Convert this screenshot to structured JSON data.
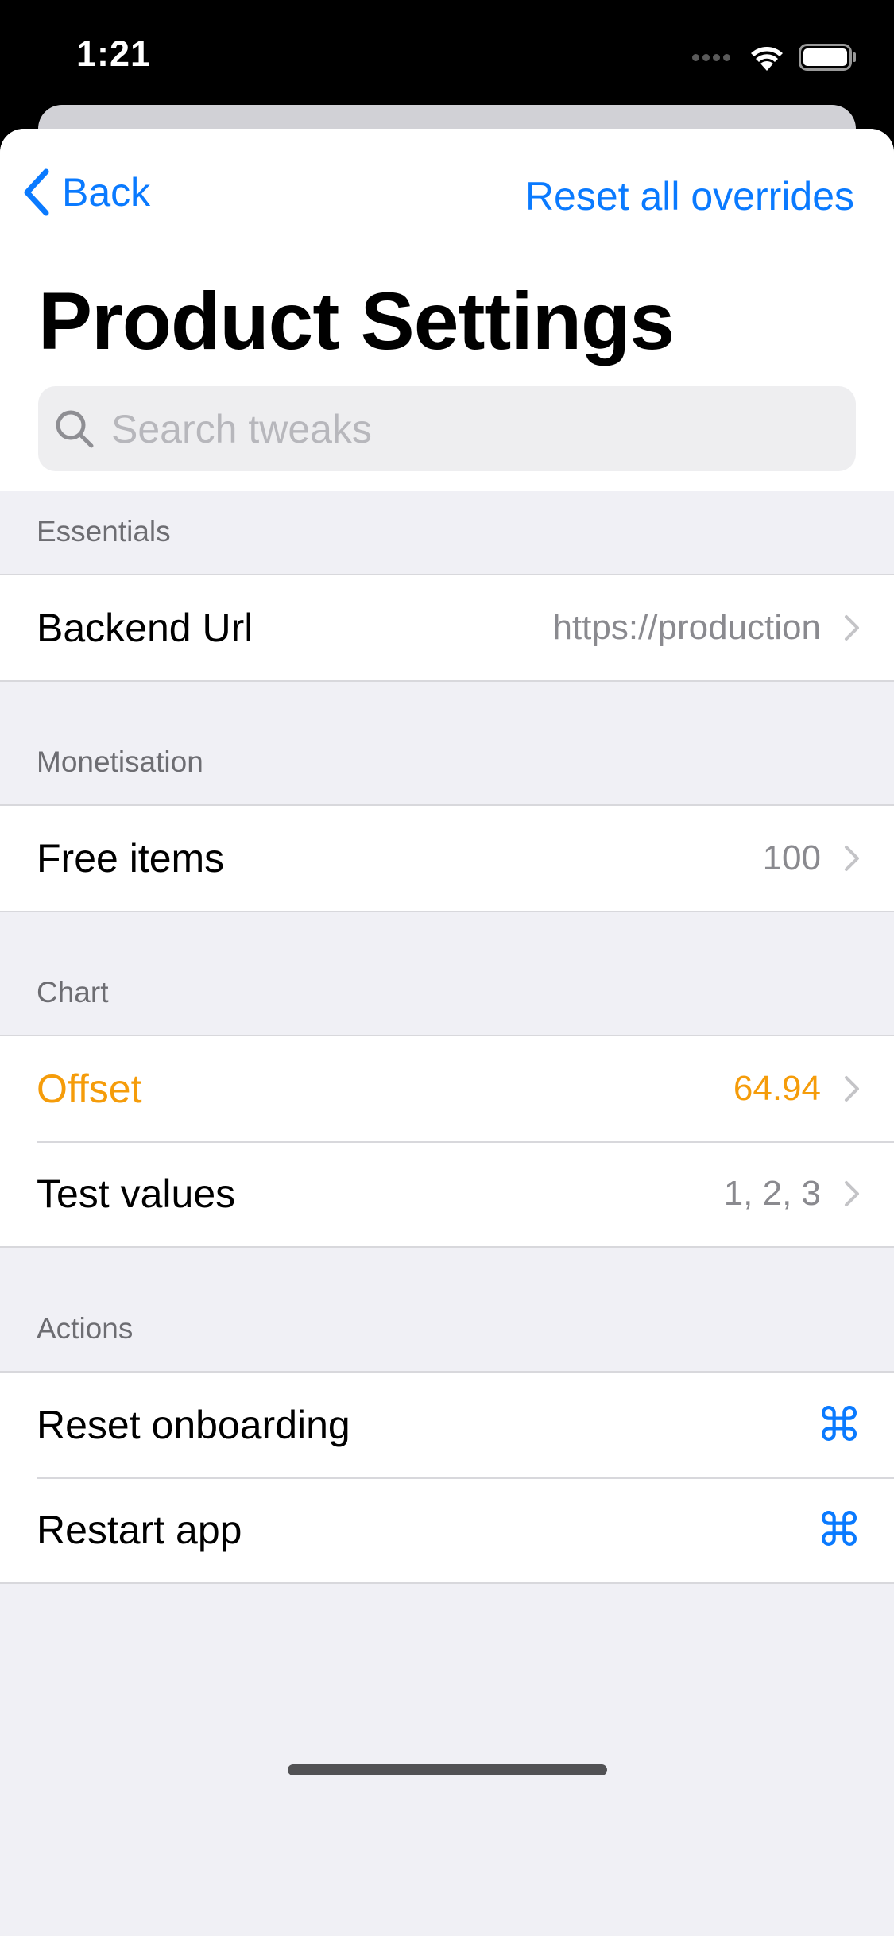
{
  "status_bar": {
    "time": "1:21",
    "icons": [
      "signal-dots-icon",
      "wifi-icon",
      "battery-icon"
    ]
  },
  "nav": {
    "back_label": "Back",
    "reset_label": "Reset all overrides"
  },
  "title": "Product Settings",
  "search": {
    "placeholder": "Search tweaks",
    "value": ""
  },
  "sections": [
    {
      "header": "Essentials",
      "rows": [
        {
          "label": "Backend Url",
          "value": "https://production"
        }
      ]
    },
    {
      "header": "Monetisation",
      "rows": [
        {
          "label": "Free items",
          "value": "100"
        }
      ]
    },
    {
      "header": "Chart",
      "rows": [
        {
          "label": "Offset",
          "value": "64.94",
          "overridden": true
        },
        {
          "label": "Test values",
          "value": "1, 2, 3"
        }
      ]
    },
    {
      "header": "Actions",
      "rows": [
        {
          "label": "Reset onboarding",
          "icon": "command-icon",
          "icon_glyph": "⌘"
        },
        {
          "label": "Restart app",
          "icon": "command-icon",
          "icon_glyph": "⌘"
        }
      ]
    }
  ],
  "colors": {
    "accent": "#0a7aff",
    "override": "#f59c0a",
    "secondary_text": "#8a8a8f",
    "grouped_background": "#f0f0f5"
  }
}
